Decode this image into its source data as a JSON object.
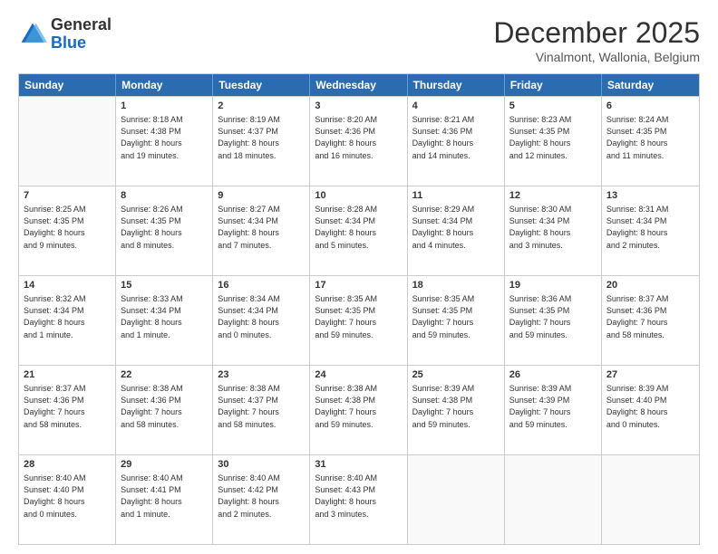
{
  "logo": {
    "general": "General",
    "blue": "Blue"
  },
  "title": "December 2025",
  "subtitle": "Vinalmont, Wallonia, Belgium",
  "header": {
    "days": [
      "Sunday",
      "Monday",
      "Tuesday",
      "Wednesday",
      "Thursday",
      "Friday",
      "Saturday"
    ]
  },
  "weeks": [
    [
      {
        "day": "",
        "lines": []
      },
      {
        "day": "1",
        "lines": [
          "Sunrise: 8:18 AM",
          "Sunset: 4:38 PM",
          "Daylight: 8 hours",
          "and 19 minutes."
        ]
      },
      {
        "day": "2",
        "lines": [
          "Sunrise: 8:19 AM",
          "Sunset: 4:37 PM",
          "Daylight: 8 hours",
          "and 18 minutes."
        ]
      },
      {
        "day": "3",
        "lines": [
          "Sunrise: 8:20 AM",
          "Sunset: 4:36 PM",
          "Daylight: 8 hours",
          "and 16 minutes."
        ]
      },
      {
        "day": "4",
        "lines": [
          "Sunrise: 8:21 AM",
          "Sunset: 4:36 PM",
          "Daylight: 8 hours",
          "and 14 minutes."
        ]
      },
      {
        "day": "5",
        "lines": [
          "Sunrise: 8:23 AM",
          "Sunset: 4:35 PM",
          "Daylight: 8 hours",
          "and 12 minutes."
        ]
      },
      {
        "day": "6",
        "lines": [
          "Sunrise: 8:24 AM",
          "Sunset: 4:35 PM",
          "Daylight: 8 hours",
          "and 11 minutes."
        ]
      }
    ],
    [
      {
        "day": "7",
        "lines": [
          "Sunrise: 8:25 AM",
          "Sunset: 4:35 PM",
          "Daylight: 8 hours",
          "and 9 minutes."
        ]
      },
      {
        "day": "8",
        "lines": [
          "Sunrise: 8:26 AM",
          "Sunset: 4:35 PM",
          "Daylight: 8 hours",
          "and 8 minutes."
        ]
      },
      {
        "day": "9",
        "lines": [
          "Sunrise: 8:27 AM",
          "Sunset: 4:34 PM",
          "Daylight: 8 hours",
          "and 7 minutes."
        ]
      },
      {
        "day": "10",
        "lines": [
          "Sunrise: 8:28 AM",
          "Sunset: 4:34 PM",
          "Daylight: 8 hours",
          "and 5 minutes."
        ]
      },
      {
        "day": "11",
        "lines": [
          "Sunrise: 8:29 AM",
          "Sunset: 4:34 PM",
          "Daylight: 8 hours",
          "and 4 minutes."
        ]
      },
      {
        "day": "12",
        "lines": [
          "Sunrise: 8:30 AM",
          "Sunset: 4:34 PM",
          "Daylight: 8 hours",
          "and 3 minutes."
        ]
      },
      {
        "day": "13",
        "lines": [
          "Sunrise: 8:31 AM",
          "Sunset: 4:34 PM",
          "Daylight: 8 hours",
          "and 2 minutes."
        ]
      }
    ],
    [
      {
        "day": "14",
        "lines": [
          "Sunrise: 8:32 AM",
          "Sunset: 4:34 PM",
          "Daylight: 8 hours",
          "and 1 minute."
        ]
      },
      {
        "day": "15",
        "lines": [
          "Sunrise: 8:33 AM",
          "Sunset: 4:34 PM",
          "Daylight: 8 hours",
          "and 1 minute."
        ]
      },
      {
        "day": "16",
        "lines": [
          "Sunrise: 8:34 AM",
          "Sunset: 4:34 PM",
          "Daylight: 8 hours",
          "and 0 minutes."
        ]
      },
      {
        "day": "17",
        "lines": [
          "Sunrise: 8:35 AM",
          "Sunset: 4:35 PM",
          "Daylight: 7 hours",
          "and 59 minutes."
        ]
      },
      {
        "day": "18",
        "lines": [
          "Sunrise: 8:35 AM",
          "Sunset: 4:35 PM",
          "Daylight: 7 hours",
          "and 59 minutes."
        ]
      },
      {
        "day": "19",
        "lines": [
          "Sunrise: 8:36 AM",
          "Sunset: 4:35 PM",
          "Daylight: 7 hours",
          "and 59 minutes."
        ]
      },
      {
        "day": "20",
        "lines": [
          "Sunrise: 8:37 AM",
          "Sunset: 4:36 PM",
          "Daylight: 7 hours",
          "and 58 minutes."
        ]
      }
    ],
    [
      {
        "day": "21",
        "lines": [
          "Sunrise: 8:37 AM",
          "Sunset: 4:36 PM",
          "Daylight: 7 hours",
          "and 58 minutes."
        ]
      },
      {
        "day": "22",
        "lines": [
          "Sunrise: 8:38 AM",
          "Sunset: 4:36 PM",
          "Daylight: 7 hours",
          "and 58 minutes."
        ]
      },
      {
        "day": "23",
        "lines": [
          "Sunrise: 8:38 AM",
          "Sunset: 4:37 PM",
          "Daylight: 7 hours",
          "and 58 minutes."
        ]
      },
      {
        "day": "24",
        "lines": [
          "Sunrise: 8:38 AM",
          "Sunset: 4:38 PM",
          "Daylight: 7 hours",
          "and 59 minutes."
        ]
      },
      {
        "day": "25",
        "lines": [
          "Sunrise: 8:39 AM",
          "Sunset: 4:38 PM",
          "Daylight: 7 hours",
          "and 59 minutes."
        ]
      },
      {
        "day": "26",
        "lines": [
          "Sunrise: 8:39 AM",
          "Sunset: 4:39 PM",
          "Daylight: 7 hours",
          "and 59 minutes."
        ]
      },
      {
        "day": "27",
        "lines": [
          "Sunrise: 8:39 AM",
          "Sunset: 4:40 PM",
          "Daylight: 8 hours",
          "and 0 minutes."
        ]
      }
    ],
    [
      {
        "day": "28",
        "lines": [
          "Sunrise: 8:40 AM",
          "Sunset: 4:40 PM",
          "Daylight: 8 hours",
          "and 0 minutes."
        ]
      },
      {
        "day": "29",
        "lines": [
          "Sunrise: 8:40 AM",
          "Sunset: 4:41 PM",
          "Daylight: 8 hours",
          "and 1 minute."
        ]
      },
      {
        "day": "30",
        "lines": [
          "Sunrise: 8:40 AM",
          "Sunset: 4:42 PM",
          "Daylight: 8 hours",
          "and 2 minutes."
        ]
      },
      {
        "day": "31",
        "lines": [
          "Sunrise: 8:40 AM",
          "Sunset: 4:43 PM",
          "Daylight: 8 hours",
          "and 3 minutes."
        ]
      },
      {
        "day": "",
        "lines": []
      },
      {
        "day": "",
        "lines": []
      },
      {
        "day": "",
        "lines": []
      }
    ]
  ]
}
